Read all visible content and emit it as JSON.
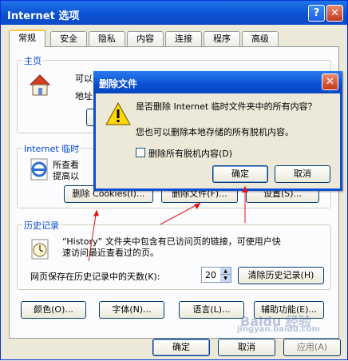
{
  "window": {
    "title": "Internet 选项",
    "help_btn": "?",
    "close_btn": "✕"
  },
  "tabs": [
    "常规",
    "安全",
    "隐私",
    "内容",
    "连接",
    "程序",
    "高级"
  ],
  "homepage": {
    "legend": "主页",
    "line1": "可以更",
    "address_label": "地址",
    "button_partial": "使"
  },
  "temp_files": {
    "legend": "Internet 临时",
    "line1": "所查看",
    "line2": "提高以",
    "delete_cookies": "删除 Cookies(I)...",
    "delete_files": "删除文件(F)...",
    "settings": "设置(S)..."
  },
  "history": {
    "legend": "历史记录",
    "desc_line1": "“History” 文件夹中包含有已访问页的链接，可使用户快",
    "desc_line2": "速访问最近查看过的页。",
    "days_label": "网页保存在历史记录中的天数(K):",
    "days_value": "20",
    "clear_button": "清除历史记录(H)"
  },
  "bottom_buttons": {
    "colors": "颜色(O)...",
    "fonts": "字体(N)...",
    "languages": "语言(L)...",
    "accessibility": "辅助功能(E)..."
  },
  "footer": {
    "ok": "确定",
    "cancel": "取消",
    "apply": "应用(A)"
  },
  "dialog": {
    "title": "删除文件",
    "question": "是否删除 Internet 临时文件夹中的所有内容？",
    "info": "您也可以删除本地存储的所有脱机内容。",
    "checkbox_label": "删除所有脱机内容(D)",
    "ok": "确定",
    "cancel": "取消",
    "close_btn": "✕"
  },
  "watermark": {
    "line1": "Baidu 经验",
    "line2": "jingyan.baidu.com"
  },
  "colors": {
    "title_blue": "#0a4fd1",
    "legend_blue": "#0046d5",
    "annotation_red": "#e01010"
  }
}
